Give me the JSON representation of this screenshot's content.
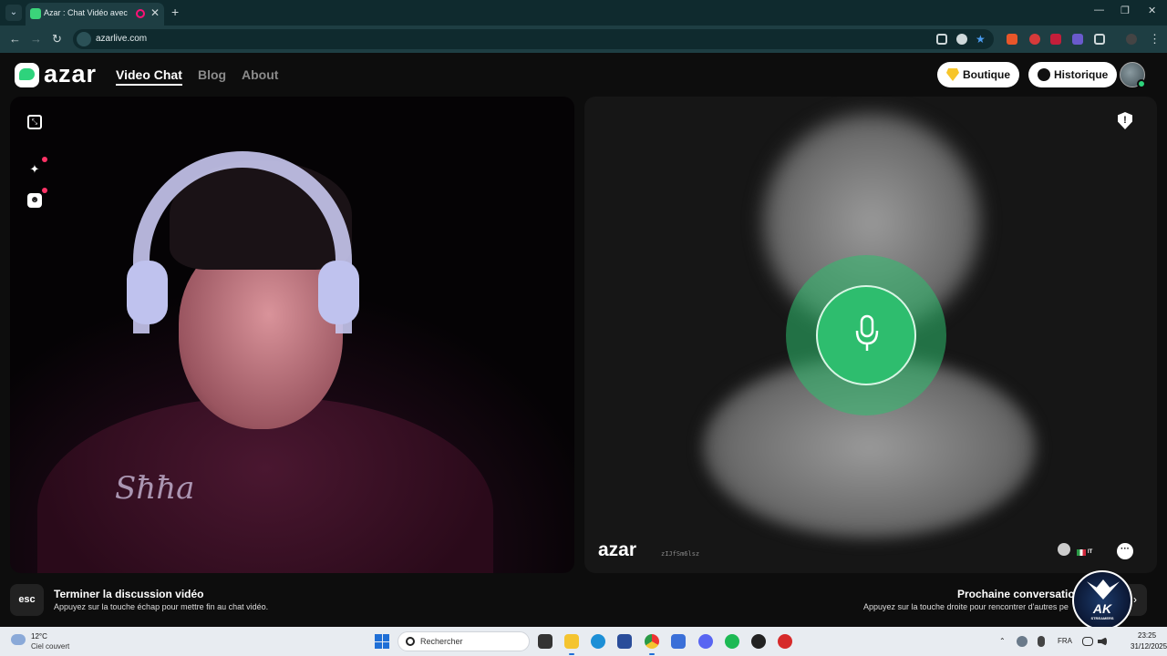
{
  "browser": {
    "tab_title": "Azar : Chat Vidéo avec de n",
    "url": "azarlive.com"
  },
  "site": {
    "logo": "azar",
    "nav": [
      "Video Chat",
      "Blog",
      "About"
    ],
    "boutique_label": "Boutique",
    "historique_label": "Historique"
  },
  "remote": {
    "watermark": "azar",
    "session_id": "zIJfSm6lsz",
    "country_code": "IT"
  },
  "local": {
    "hoodie_print": "Sħħa"
  },
  "hints": {
    "esc_key": "esc",
    "end_title": "Terminer la discussion vidéo",
    "end_sub": "Appuyez sur la touche échap pour mettre fin au chat vidéo.",
    "next_title": "Prochaine conversation",
    "next_sub": "Appuyez sur la touche droite pour rencontrer d'autres pe",
    "next_key": "›"
  },
  "badge": {
    "brand": "AK",
    "sub": "STREAMERS"
  },
  "taskbar": {
    "temp": "12°C",
    "condition": "Ciel couvert",
    "search_placeholder": "Rechercher",
    "lang": "FRA",
    "time": "23:25",
    "date": "31/12/2025"
  },
  "colors": {
    "brand_green": "#2ed37c",
    "tab_bg": "#1e3e43",
    "badge_red": "#ff3366"
  }
}
